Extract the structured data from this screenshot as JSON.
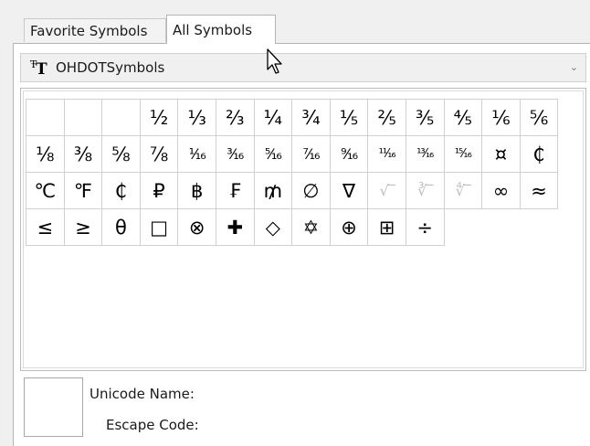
{
  "tabs": {
    "favorites": "Favorite Symbols",
    "all": "All Symbols"
  },
  "font_selector": {
    "icon": "font-type-icon",
    "value": "OHDOTSymbols",
    "chevron": "⌄"
  },
  "symbols": [
    "",
    "",
    "",
    "½",
    "⅓",
    "⅔",
    "¼",
    "¾",
    "⅕",
    "⅖",
    "⅗",
    "⅘",
    "⅙",
    "⅚",
    "⅛",
    "⅜",
    "⅝",
    "⅞",
    "¹⁄₁₆",
    "³⁄₁₆",
    "⁵⁄₁₆",
    "⁷⁄₁₆",
    "⁹⁄₁₆",
    "¹¹⁄₁₆",
    "¹³⁄₁₆",
    "¹⁵⁄₁₆",
    "¤",
    "₵",
    "℃",
    "℉",
    "₵",
    "₽",
    "฿",
    "₣",
    "₥",
    "∅",
    "∇",
    "√‾",
    "∛‾",
    "∜‾",
    "∞",
    "≈",
    "≤",
    "≥",
    "θ",
    "□",
    "⊗",
    "✚",
    "◇",
    "✡",
    "⊕",
    "⊞",
    "÷"
  ],
  "info": {
    "unicode_name_label": "Unicode Name:",
    "escape_code_label": "Escape Code:"
  }
}
